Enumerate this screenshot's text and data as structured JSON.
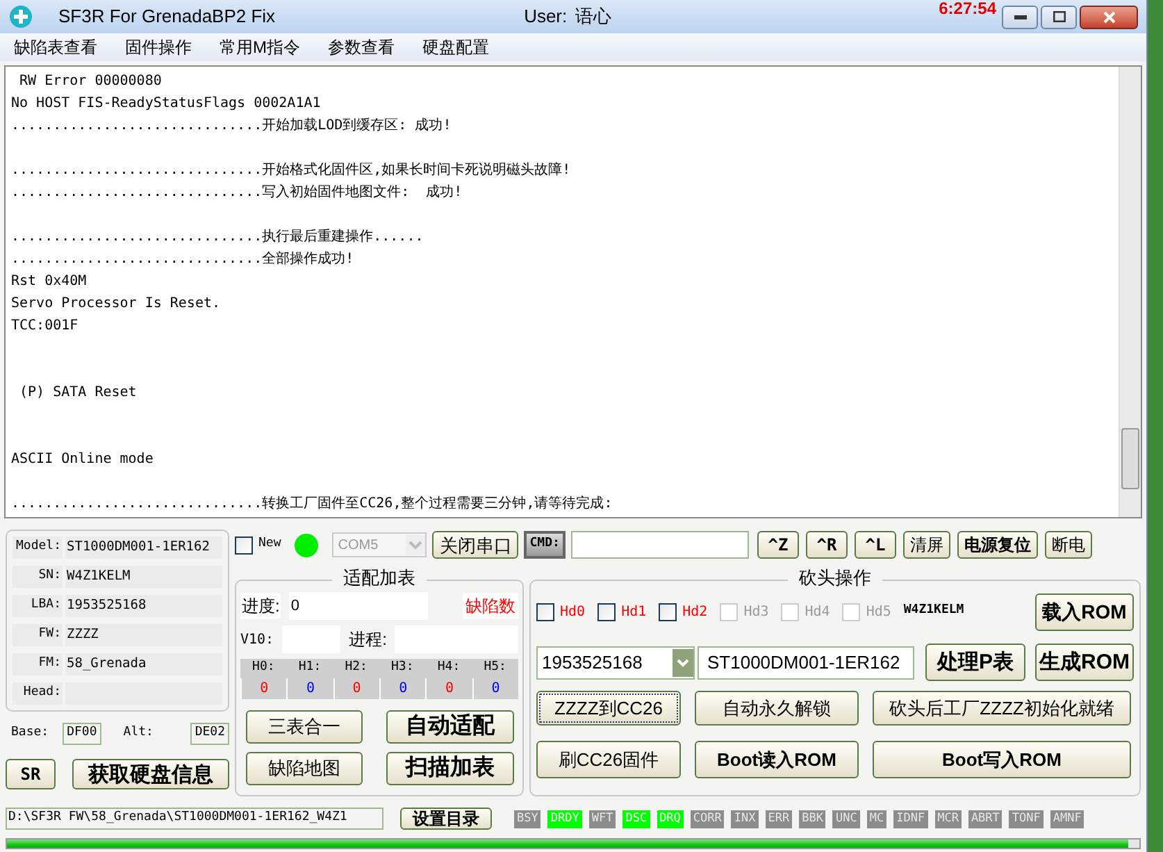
{
  "window": {
    "title": "SF3R For GrenadaBP2 Fix",
    "user_label": "User:",
    "user": "语心",
    "clock": "6:27:54"
  },
  "menu": [
    "缺陷表查看",
    "固件操作",
    "常用M指令",
    "参数查看",
    "硬盘配置"
  ],
  "log": [
    {
      "kind": "line",
      "text": " RW Error 00000080"
    },
    {
      "kind": "line",
      "text": "No HOST FIS-ReadyStatusFlags 0002A1A1"
    },
    {
      "kind": "line",
      "text": "..............................开始加载LOD到缓存区: 成功!"
    },
    {
      "kind": "blank"
    },
    {
      "kind": "line",
      "text": "..............................开始格式化固件区,如果长时间卡死说明磁头故障!"
    },
    {
      "kind": "line",
      "text": "..............................写入初始固件地图文件:  成功!"
    },
    {
      "kind": "blank"
    },
    {
      "kind": "line",
      "text": "..............................执行最后重建操作......"
    },
    {
      "kind": "line",
      "text": "..............................全部操作成功!"
    },
    {
      "kind": "line",
      "text": "Rst 0x40M"
    },
    {
      "kind": "line",
      "text": "Servo Processor Is Reset."
    },
    {
      "kind": "line",
      "text": "TCC:001F"
    },
    {
      "kind": "blank"
    },
    {
      "kind": "blank"
    },
    {
      "kind": "line",
      "text": " (P) SATA Reset"
    },
    {
      "kind": "blank"
    },
    {
      "kind": "blank"
    },
    {
      "kind": "line",
      "text": "ASCII Online mode"
    },
    {
      "kind": "blank"
    },
    {
      "kind": "line",
      "text": "..............................转换工厂固件至CC26,整个过程需要三分钟,请等待完成:"
    }
  ],
  "drive_info": [
    {
      "label": "Model:",
      "value": "ST1000DM001-1ER162"
    },
    {
      "label": "SN:",
      "value": "W4Z1KELM"
    },
    {
      "label": "LBA:",
      "value": "1953525168"
    },
    {
      "label": "FW:",
      "value": "ZZZZ"
    },
    {
      "label": "FM:",
      "value": "58_Grenada"
    },
    {
      "label": "Head:"
    }
  ],
  "base": {
    "label": "Base:",
    "value": "DF00"
  },
  "alt": {
    "label": "Alt:",
    "value": "DE02"
  },
  "left_buttons": [
    "SR",
    "获取硬盘信息"
  ],
  "path": "D:\\SF3R FW\\58_Grenada\\ST1000DM001-1ER162_W4Z1",
  "set_dir_button": "设置目录",
  "toolbar": {
    "new_checkbox": {
      "label": "New",
      "checked": false
    },
    "port_connected": true,
    "port": "COM5",
    "close_port": "关闭串口",
    "cmd_label": "CMD:",
    "buttons": [
      "^Z",
      "^R",
      "^L",
      "清屏",
      "电源复位",
      "断电"
    ]
  },
  "adapt": {
    "title": "适配加表",
    "progress_label": "进度:",
    "progress_value": "0",
    "defects_label": "缺陷数",
    "v10_label": "V10:",
    "process_label": "进程:",
    "heads": [
      {
        "label": "H0:",
        "value": "0",
        "color": "#ff0000"
      },
      {
        "label": "H1:",
        "value": "0",
        "color": "#0000ff"
      },
      {
        "label": "H2:",
        "value": "0",
        "color": "#ff0000"
      },
      {
        "label": "H3:",
        "value": "0",
        "color": "#0000ff"
      },
      {
        "label": "H4:",
        "value": "0",
        "color": "#ff0000"
      },
      {
        "label": "H5:",
        "value": "0",
        "color": "#0000ff"
      }
    ],
    "buttons": [
      {
        "label": "三表合一",
        "bold": false
      },
      {
        "label": "自动适配",
        "bold": true
      },
      {
        "label": "缺陷地图",
        "bold": false
      },
      {
        "label": "扫描加表",
        "bold": true
      }
    ]
  },
  "head_cut": {
    "title": "砍头操作",
    "heads": [
      {
        "label": "Hd0",
        "checked": false,
        "disabled": false
      },
      {
        "label": "Hd1",
        "checked": false,
        "disabled": false
      },
      {
        "label": "Hd2",
        "checked": false,
        "disabled": false
      },
      {
        "label": "Hd3",
        "checked": false,
        "disabled": true
      },
      {
        "label": "Hd4",
        "checked": false,
        "disabled": true
      },
      {
        "label": "Hd5",
        "checked": false,
        "disabled": true
      }
    ],
    "serial": "W4Z1KELM",
    "lba": "1953525168",
    "model": "ST1000DM001-1ER162",
    "buttons": {
      "load_rom": "载入ROM",
      "process_p": "处理P表",
      "gen_rom": "生成ROM",
      "zzzz_cc26": "ZZZZ到CC26",
      "unlock": "自动永久解锁",
      "init": "砍头后工厂ZZZZ初始化就绪",
      "flash_cc26": "刷CC26固件",
      "boot_read": "Boot读入ROM",
      "boot_write": "Boot写入ROM"
    }
  },
  "status_flags": [
    {
      "label": "BSY",
      "on": false
    },
    {
      "label": "DRDY",
      "on": true
    },
    {
      "label": "WFT",
      "on": false
    },
    {
      "label": "DSC",
      "on": true
    },
    {
      "label": "DRQ",
      "on": true
    },
    {
      "label": "CORR",
      "on": false
    },
    {
      "label": "INX",
      "on": false
    },
    {
      "label": "ERR",
      "on": false
    },
    {
      "label": "BBK",
      "on": false
    },
    {
      "label": "UNC",
      "on": false
    },
    {
      "label": "MC",
      "on": false
    },
    {
      "label": "IDNF",
      "on": false
    },
    {
      "label": "MCR",
      "on": false
    },
    {
      "label": "ABRT",
      "on": false
    },
    {
      "label": "TONF",
      "on": false
    },
    {
      "label": "AMNF",
      "on": false
    }
  ],
  "progress": {
    "level": 0.99
  }
}
